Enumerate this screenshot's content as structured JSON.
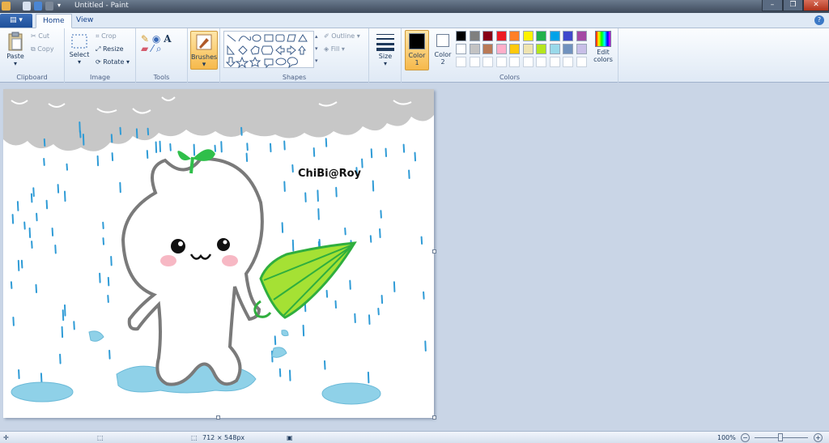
{
  "window": {
    "title": "Untitled - Paint",
    "minimize": "–",
    "restore": "❐",
    "close": "✕"
  },
  "menu": {
    "file_button": "▤ ▾",
    "tabs": [
      "Home",
      "View"
    ],
    "help": "?"
  },
  "ribbon": {
    "clipboard": {
      "label": "Clipboard",
      "paste": "Paste",
      "cut": "Cut",
      "copy": "Copy"
    },
    "image": {
      "label": "Image",
      "select": "Select",
      "crop": "Crop",
      "resize": "Resize",
      "rotate": "Rotate"
    },
    "tools": {
      "label": "Tools"
    },
    "brushes": {
      "label": "Brushes"
    },
    "shapes": {
      "label": "Shapes",
      "outline": "Outline",
      "fill": "Fill"
    },
    "size": {
      "label": "Size"
    },
    "colors": {
      "label": "Colors",
      "color1_label": "Color",
      "color1_num": "1",
      "color2_label": "Color",
      "color2_num": "2",
      "edit_colors_line1": "Edit",
      "edit_colors_line2": "colors",
      "color1": "#000000",
      "color2": "#ffffff",
      "palette_row1": [
        "#000000",
        "#7f7f7f",
        "#880015",
        "#ed1c24",
        "#ff7f27",
        "#fff200",
        "#22b14c",
        "#00a2e8",
        "#3f48cc",
        "#a349a4"
      ],
      "palette_row2": [
        "#ffffff",
        "#c3c3c3",
        "#b97a57",
        "#ffaec9",
        "#ffc90e",
        "#efe4b0",
        "#b5e61d",
        "#99d9ea",
        "#7092be",
        "#c8bfe7"
      ],
      "palette_row3": [
        "#ffffff",
        "#ffffff",
        "#ffffff",
        "#ffffff",
        "#ffffff",
        "#ffffff",
        "#ffffff",
        "#ffffff",
        "#ffffff",
        "#ffffff"
      ]
    }
  },
  "canvas": {
    "signature": "ChiBi@Roy"
  },
  "status": {
    "dimensions": "712 × 548px",
    "zoom": "100%"
  }
}
